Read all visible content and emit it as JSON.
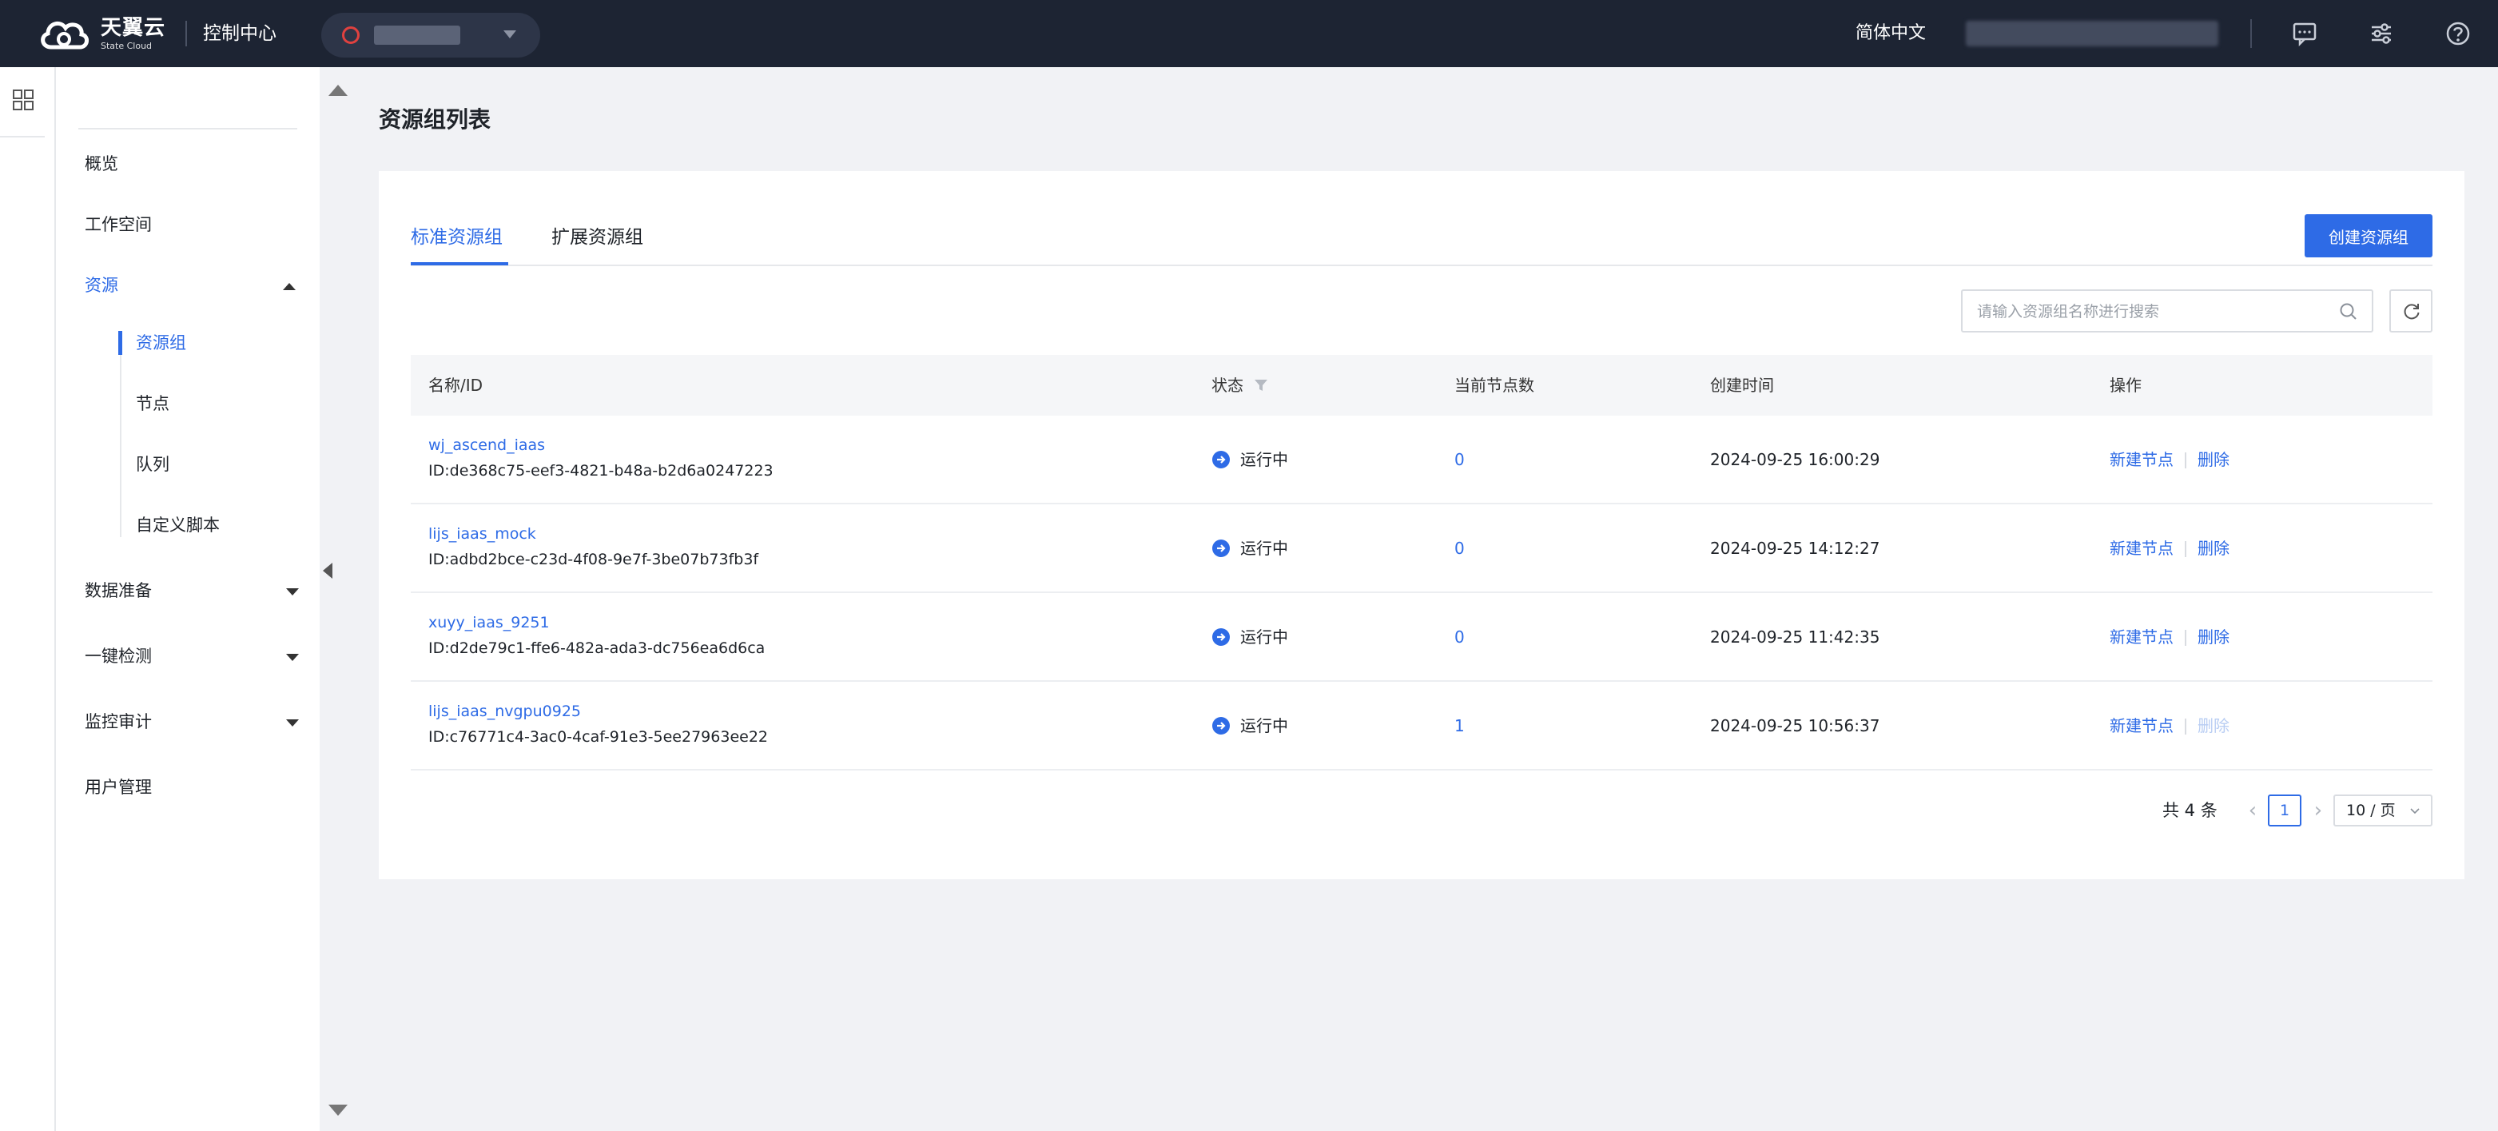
{
  "header": {
    "brand_cn": "天翼云",
    "brand_en": "State Cloud",
    "console": "控制中心",
    "language": "简体中文"
  },
  "sidebar": {
    "items": [
      {
        "label": "概览"
      },
      {
        "label": "工作空间"
      },
      {
        "label": "资源",
        "expanded": true,
        "active": true
      },
      {
        "label": "数据准备"
      },
      {
        "label": "一键检测"
      },
      {
        "label": "监控审计"
      },
      {
        "label": "用户管理"
      }
    ],
    "sub_items": [
      {
        "label": "资源组",
        "active": true
      },
      {
        "label": "节点"
      },
      {
        "label": "队列"
      },
      {
        "label": "自定义脚本"
      }
    ]
  },
  "page": {
    "title": "资源组列表",
    "tabs": [
      {
        "label": "标准资源组",
        "active": true
      },
      {
        "label": "扩展资源组"
      }
    ],
    "create_button": "创建资源组",
    "search_placeholder": "请输入资源组名称进行搜索"
  },
  "table": {
    "columns": [
      "名称/ID",
      "状态",
      "当前节点数",
      "创建时间",
      "操作"
    ],
    "rows": [
      {
        "name": "wj_ascend_iaas",
        "id": "ID:de368c75-eef3-4821-b48a-b2d6a0247223",
        "status": "运行中",
        "nodes": "0",
        "created": "2024-09-25 16:00:29",
        "op1": "新建节点",
        "op2": "删除",
        "op2_disabled": false
      },
      {
        "name": "lijs_iaas_mock",
        "id": "ID:adbd2bce-c23d-4f08-9e7f-3be07b73fb3f",
        "status": "运行中",
        "nodes": "0",
        "created": "2024-09-25 14:12:27",
        "op1": "新建节点",
        "op2": "删除",
        "op2_disabled": false
      },
      {
        "name": "xuyy_iaas_9251",
        "id": "ID:d2de79c1-ffe6-482a-ada3-dc756ea6d6ca",
        "status": "运行中",
        "nodes": "0",
        "created": "2024-09-25 11:42:35",
        "op1": "新建节点",
        "op2": "删除",
        "op2_disabled": false
      },
      {
        "name": "lijs_iaas_nvgpu0925",
        "id": "ID:c76771c4-3ac0-4caf-91e3-5ee27963ee22",
        "status": "运行中",
        "nodes": "1",
        "created": "2024-09-25 10:56:37",
        "op1": "新建节点",
        "op2": "删除",
        "op2_disabled": true
      }
    ]
  },
  "pagination": {
    "total": "共 4 条",
    "current_page": "1",
    "page_size": "10 / 页"
  },
  "colors": {
    "accent": "#2e6be6",
    "topbar": "#1d2433",
    "background": "#f1f2f5"
  },
  "icons": [
    "state-cloud-logo-icon",
    "region-icon",
    "chevron-down-icon",
    "message-icon",
    "settings-sliders-icon",
    "help-icon",
    "grid-icon",
    "search-icon",
    "refresh-icon",
    "filter-icon",
    "running-status-icon",
    "chevron-left-icon",
    "chevron-right-icon"
  ]
}
